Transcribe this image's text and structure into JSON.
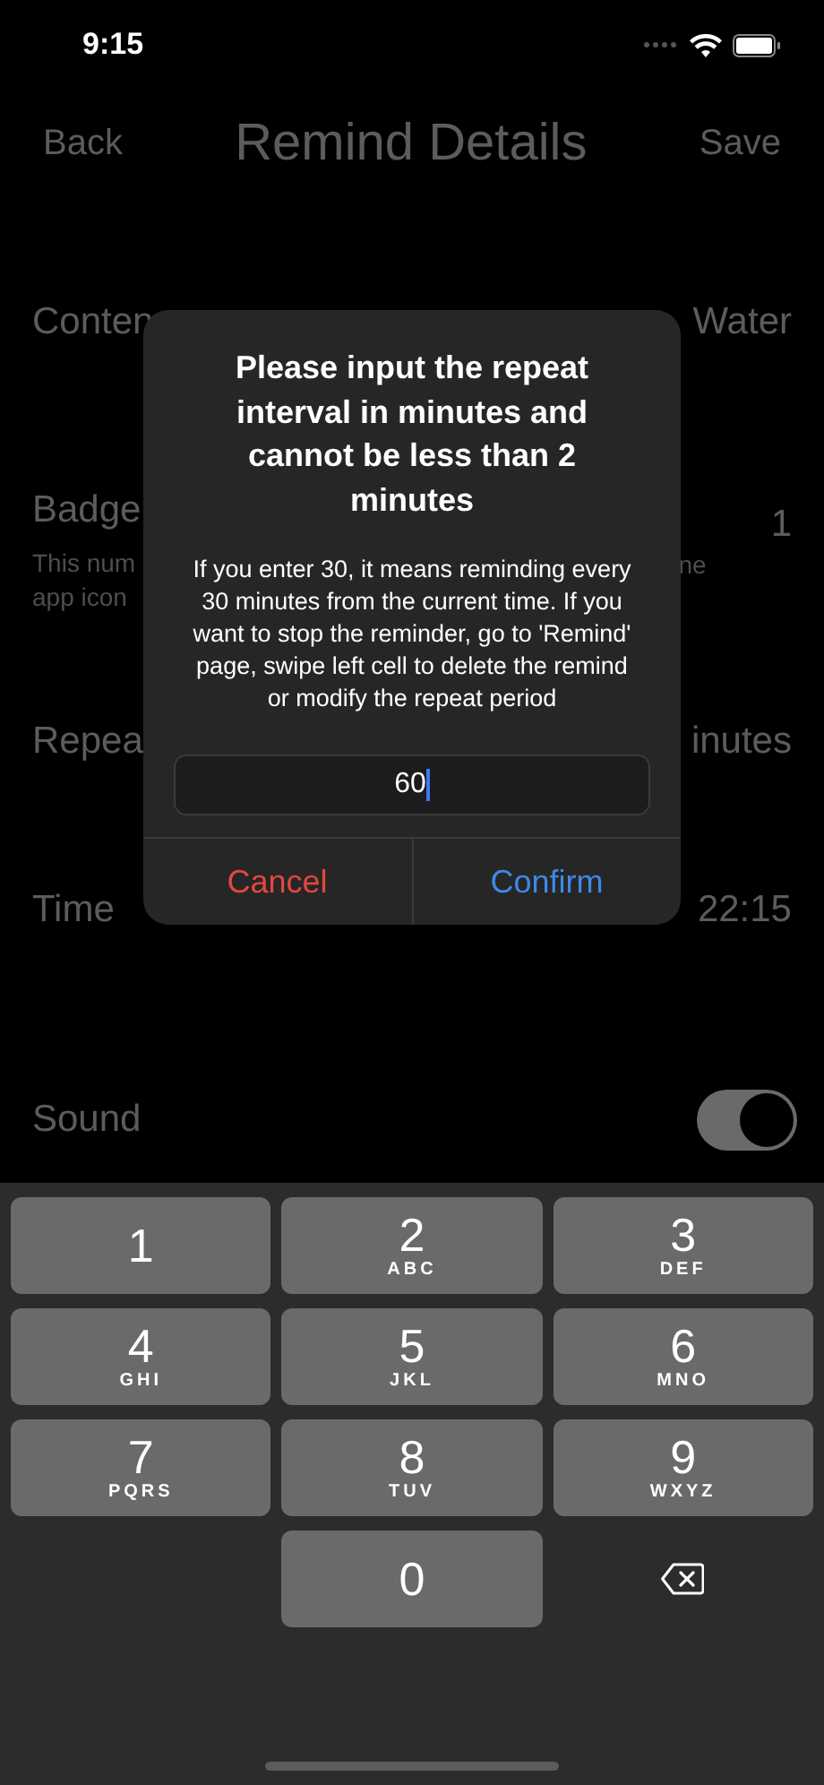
{
  "status_bar": {
    "time": "9:15"
  },
  "nav": {
    "back": "Back",
    "title": "Remind Details",
    "save": "Save"
  },
  "rows": [
    {
      "kind": "text",
      "label": "Conten",
      "value": "Water"
    },
    {
      "kind": "badge",
      "label": "Badge",
      "description": [
        "This num",
        "app icon"
      ],
      "description_end": "ne",
      "value": "1"
    },
    {
      "kind": "text",
      "label": "Repea",
      "value": "inutes"
    },
    {
      "kind": "text",
      "label": "Time",
      "value": "22:15"
    },
    {
      "kind": "toggle",
      "label": "Sound",
      "on": true
    }
  ],
  "dialog": {
    "title": "Please input the repeat interval in minutes and cannot be less than 2 minutes",
    "message": "If you enter 30, it means reminding every 30 minutes from the current time. If you want to stop the reminder, go to 'Remind' page, swipe left cell to delete the remind or modify the repeat period",
    "field": {
      "value": "60"
    },
    "buttons": [
      {
        "kind": "cancel",
        "label": "Cancel"
      },
      {
        "kind": "confirm",
        "label": "Confirm"
      }
    ]
  },
  "keyboard": {
    "keys": [
      {
        "kind": "digit",
        "digit": "1"
      },
      {
        "kind": "digit",
        "digit": "2",
        "letters": "ABC"
      },
      {
        "kind": "digit",
        "digit": "3",
        "letters": "DEF"
      },
      {
        "kind": "digit",
        "digit": "4",
        "letters": "GHI"
      },
      {
        "kind": "digit",
        "digit": "5",
        "letters": "JKL"
      },
      {
        "kind": "digit",
        "digit": "6",
        "letters": "MNO"
      },
      {
        "kind": "digit",
        "digit": "7",
        "letters": "PQRS"
      },
      {
        "kind": "digit",
        "digit": "8",
        "letters": "TUV"
      },
      {
        "kind": "digit",
        "digit": "9",
        "letters": "WXYZ"
      },
      {
        "kind": "digit",
        "digit": "0"
      },
      {
        "kind": "delete"
      }
    ]
  }
}
